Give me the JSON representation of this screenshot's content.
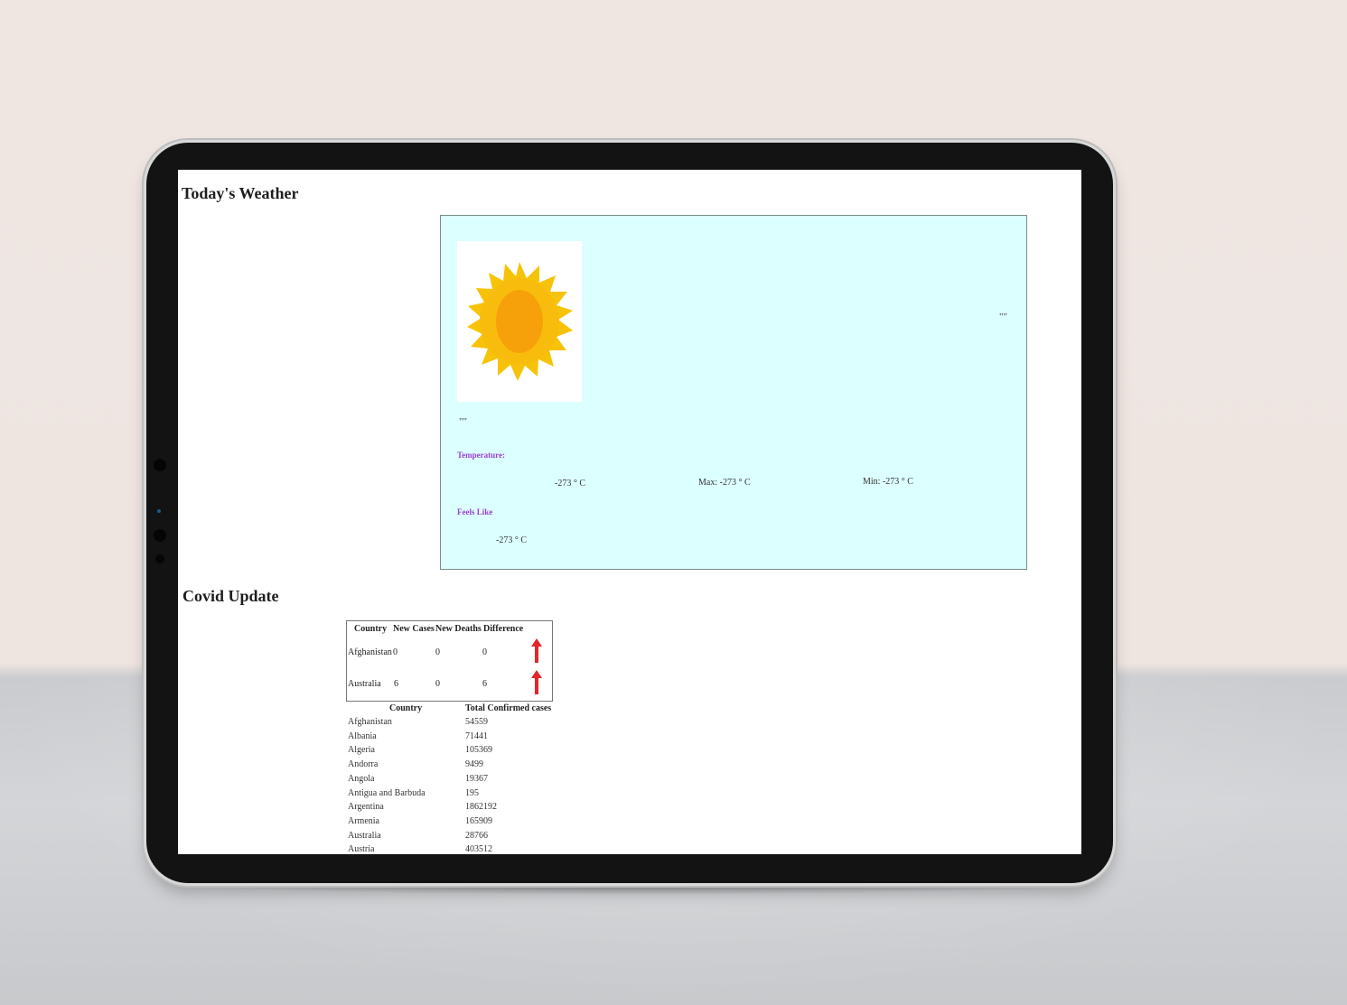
{
  "weather": {
    "heading": "Today's Weather",
    "quote_right": "\"\"",
    "quote_left": "\"\"",
    "temperature_label": "Temperature:",
    "temp": "-273 ° C",
    "max": "Max: -273 ° C",
    "min": "Min: -273 ° C",
    "feels_like_label": "Feels Like",
    "feels_like": "-273 ° C",
    "colors": {
      "card_bg": "#dcffff",
      "label": "#9a3fd0",
      "sun_outer": "#f7c30a",
      "sun_inner": "#f7a10a",
      "arrow": "#e3262b"
    },
    "icon": "sun-icon"
  },
  "covid": {
    "heading": "Covid Update",
    "table": {
      "headers": [
        "Country",
        "New Cases",
        "New Deaths",
        "Difference"
      ],
      "rows": [
        {
          "country": "Afghanistan",
          "new_cases": "0",
          "new_deaths": "0",
          "difference_icon": "up-arrow-icon"
        },
        {
          "country": "Australia",
          "new_cases": "6",
          "new_deaths": "0",
          "difference": "6",
          "difference_icon": "up-arrow-icon"
        }
      ],
      "afghanistan_difference": "0"
    },
    "list": {
      "headers": [
        "Country",
        "Total Confirmed cases"
      ],
      "rows": [
        [
          "Afghanistan",
          "54559"
        ],
        [
          "Albania",
          "71441"
        ],
        [
          "Algeria",
          "105369"
        ],
        [
          "Andorra",
          "9499"
        ],
        [
          "Angola",
          "19367"
        ],
        [
          "Antigua and Barbuda",
          "195"
        ],
        [
          "Argentina",
          "1862192"
        ],
        [
          "Armenia",
          "165909"
        ],
        [
          "Australia",
          "28766"
        ],
        [
          "Austria",
          "403512"
        ]
      ]
    }
  }
}
